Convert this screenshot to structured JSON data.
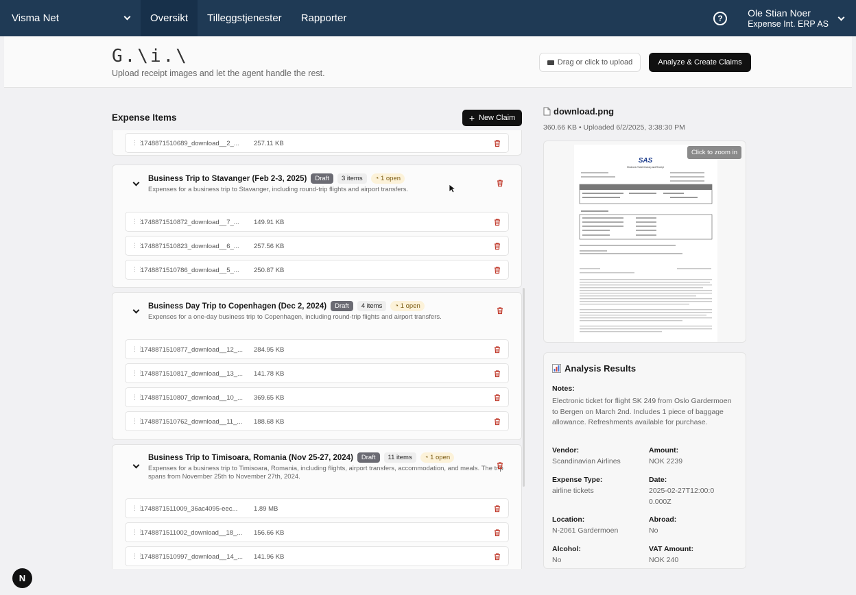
{
  "nav": {
    "brand": "Visma Net",
    "tabs": [
      "Oversikt",
      "Tilleggstjenester",
      "Rapporter"
    ],
    "help": "?",
    "user_name": "Ole Stian Noer",
    "user_org": "Expense Int. ERP AS"
  },
  "header": {
    "logo": "G.\\i.\\",
    "tagline": "Upload receipt images and let the agent handle the rest.",
    "upload_label": "Drag or click to upload",
    "analyze_label": "Analyze & Create Claims"
  },
  "expenses": {
    "title": "Expense Items",
    "new_claim": "New Claim",
    "loose_file": {
      "name": "1748871510689_download__2_...",
      "size": "257.11 KB"
    },
    "groups": [
      {
        "title": "Business Trip to Stavanger (Feb 2-3, 2025)",
        "status": "Draft",
        "items": "3 items",
        "open": "1 open",
        "desc": "Expenses for a business trip to Stavanger, including round-trip flights and airport transfers.",
        "files": [
          {
            "name": "1748871510872_download__7_...",
            "size": "149.91 KB"
          },
          {
            "name": "1748871510823_download__6_...",
            "size": "257.56 KB"
          },
          {
            "name": "1748871510786_download__5_...",
            "size": "250.87 KB"
          }
        ]
      },
      {
        "title": "Business Day Trip to Copenhagen (Dec 2, 2024)",
        "status": "Draft",
        "items": "4 items",
        "open": "1 open",
        "desc": "Expenses for a one-day business trip to Copenhagen, including round-trip flights and airport transfers.",
        "files": [
          {
            "name": "1748871510877_download__12_...",
            "size": "284.95 KB"
          },
          {
            "name": "1748871510817_download__13_...",
            "size": "141.78 KB"
          },
          {
            "name": "1748871510807_download__10_...",
            "size": "369.65 KB"
          },
          {
            "name": "1748871510762_download__11_...",
            "size": "188.68 KB"
          }
        ]
      },
      {
        "title": "Business Trip to Timisoara, Romania (Nov 25-27, 2024)",
        "status": "Draft",
        "items": "11 items",
        "open": "1 open",
        "desc": "Expenses for a business trip to Timisoara, Romania, including flights, airport transfers, accommodation, and meals. The trip spans from November 25th to November 27th, 2024.",
        "files": [
          {
            "name": "1748871511009_36ac4095-eec...",
            "size": "1.89 MB"
          },
          {
            "name": "1748871511002_download__18_...",
            "size": "156.66 KB"
          },
          {
            "name": "1748871510997_download__14_...",
            "size": "141.96 KB"
          }
        ]
      }
    ]
  },
  "preview": {
    "filename": "download.png",
    "meta": "360.66 KB • Uploaded 6/2/2025, 3:38:30 PM",
    "zoom_hint": "Click to zoom in",
    "doc_logo": "SAS",
    "doc_heading": "Electronic Ticket Itinerary and Receipt"
  },
  "analysis": {
    "title": "Analysis Results",
    "notes_label": "Notes:",
    "notes": "Electronic ticket for flight SK 249 from Oslo Gardermoen to Bergen on March 2nd. Includes 1 piece of baggage allowance. Refreshments available for purchase.",
    "vendor_label": "Vendor:",
    "vendor": "Scandinavian Airlines",
    "amount_label": "Amount:",
    "amount": "NOK 2239",
    "type_label": "Expense Type:",
    "type": "airline tickets",
    "date_label": "Date:",
    "date": "2025-02-27T12:00:00.000Z",
    "location_label": "Location:",
    "location": "N-2061 Gardermoen",
    "abroad_label": "Abroad:",
    "abroad": "No",
    "alcohol_label": "Alcohol:",
    "alcohol": "No",
    "vat_label": "VAT Amount:",
    "vat": "NOK 240"
  },
  "misc": {
    "n_badge": "N"
  }
}
